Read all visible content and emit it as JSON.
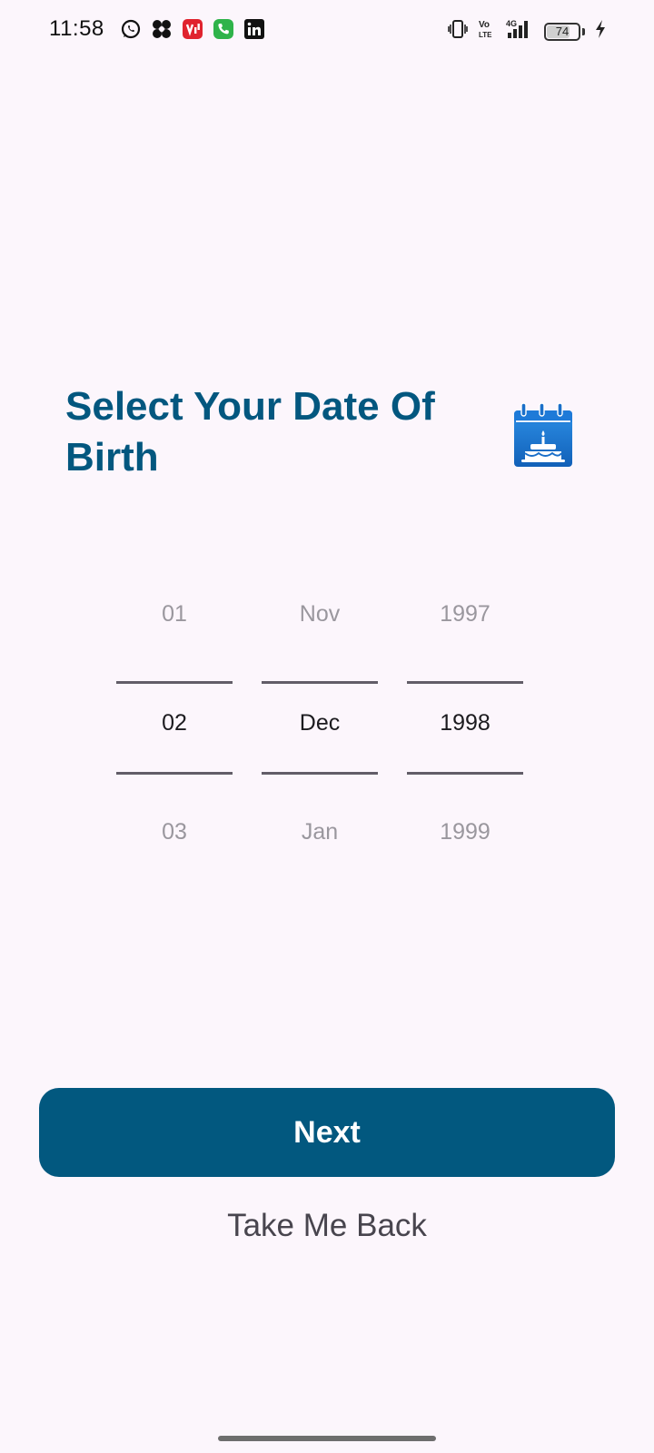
{
  "status_bar": {
    "time": "11:58",
    "battery_level": "74",
    "battery_fraction": 0.74,
    "network_label": "4G",
    "volte_label": "Vo LTE",
    "notification_icons": [
      "whatsapp-icon",
      "pinwheel-app-icon",
      "vi-app-icon",
      "phone-call-icon",
      "linkedin-icon"
    ],
    "system_icons": [
      "vibrate-icon",
      "volte-icon",
      "signal-4g-icon",
      "battery-icon",
      "charging-icon"
    ]
  },
  "screen": {
    "title": "Select Your Date Of Birth",
    "title_color": "#03577f",
    "icon": "birthday-calendar-icon"
  },
  "picker": {
    "day": {
      "prev": "01",
      "selected": "02",
      "next": "03"
    },
    "month": {
      "prev": "Nov",
      "selected": "Dec",
      "next": "Jan"
    },
    "year": {
      "prev": "1997",
      "selected": "1998",
      "next": "1999"
    }
  },
  "actions": {
    "next_label": "Next",
    "next_color": "#02587f",
    "back_label": "Take Me Back"
  },
  "colors": {
    "background": "#fcf6fc",
    "picker_divider": "#625d68",
    "picker_dim_text": "#9a979e"
  }
}
